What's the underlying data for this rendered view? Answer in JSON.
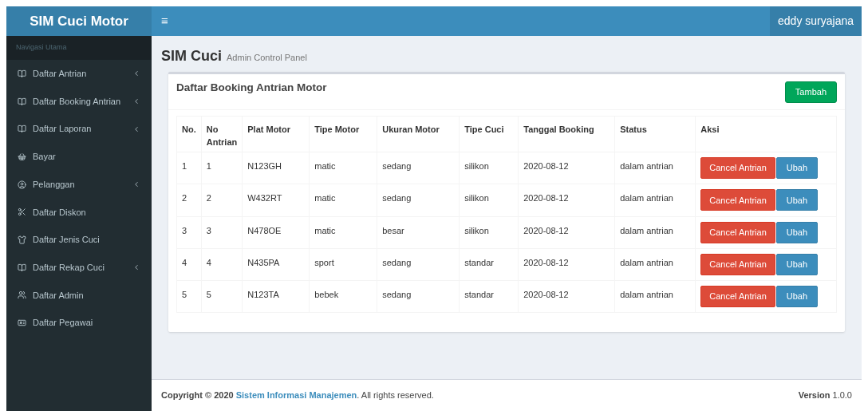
{
  "brand": "SIM Cuci Motor",
  "header": {
    "menu_toggle": "≡",
    "user": "eddy suryajana"
  },
  "sidebar": {
    "heading": "Navigasi Utama",
    "items": [
      {
        "label": "Daftar Antrian",
        "has_caret": true
      },
      {
        "label": "Daftar Booking Antrian",
        "has_caret": true
      },
      {
        "label": "Daftar Laporan",
        "has_caret": true
      },
      {
        "label": "Bayar",
        "has_caret": false
      },
      {
        "label": "Pelanggan",
        "has_caret": true
      },
      {
        "label": "Daftar Diskon",
        "has_caret": false
      },
      {
        "label": "Daftar Jenis Cuci",
        "has_caret": false
      },
      {
        "label": "Daftar Rekap Cuci",
        "has_caret": true
      },
      {
        "label": "Daftar Admin",
        "has_caret": false
      },
      {
        "label": "Daftar Pegawai",
        "has_caret": false
      }
    ]
  },
  "page": {
    "title": "SIM Cuci",
    "subtitle": "Admin Control Panel"
  },
  "box": {
    "title": "Daftar Booking Antrian Motor",
    "add_button": "Tambah"
  },
  "table": {
    "columns": [
      "No.",
      "No Antrian",
      "Plat Motor",
      "Tipe Motor",
      "Ukuran Motor",
      "Tipe Cuci",
      "Tanggal Booking",
      "Status",
      "Aksi"
    ],
    "rows": [
      {
        "cells": [
          "1",
          "1",
          "N123GH",
          "matic",
          "sedang",
          "silikon",
          "2020-08-12",
          "dalam antrian"
        ],
        "actions": [
          {
            "label": "Cancel Antrian",
            "kind": "danger"
          },
          {
            "label": "Ubah",
            "kind": "primary"
          }
        ]
      },
      {
        "cells": [
          "2",
          "2",
          "W432RT",
          "matic",
          "sedang",
          "silikon",
          "2020-08-12",
          "dalam antrian"
        ],
        "actions": [
          {
            "label": "Cancel Antrian",
            "kind": "danger"
          },
          {
            "label": "Ubah",
            "kind": "primary"
          }
        ]
      },
      {
        "cells": [
          "3",
          "3",
          "N478OE",
          "matic",
          "besar",
          "silikon",
          "2020-08-12",
          "dalam antrian"
        ],
        "actions": [
          {
            "label": "Cancel Antrian",
            "kind": "danger"
          },
          {
            "label": "Ubah",
            "kind": "primary"
          }
        ]
      },
      {
        "cells": [
          "4",
          "4",
          "N435PA",
          "sport",
          "sedang",
          "standar",
          "2020-08-12",
          "dalam antrian"
        ],
        "actions": [
          {
            "label": "Cancel Antrian",
            "kind": "danger"
          },
          {
            "label": "Ubah",
            "kind": "primary"
          }
        ]
      },
      {
        "cells": [
          "5",
          "5",
          "N123TA",
          "bebek",
          "sedang",
          "standar",
          "2020-08-12",
          "dalam antrian"
        ],
        "actions": [
          {
            "label": "Cancel Antrian",
            "kind": "danger"
          },
          {
            "label": "Ubah",
            "kind": "primary"
          }
        ]
      }
    ]
  },
  "footer": {
    "prefix": "Copyright © 2020",
    "link": "Sistem Informasi Manajemen",
    "suffix": ". All rights reserved.",
    "version": "**Version** 1.0.0"
  }
}
